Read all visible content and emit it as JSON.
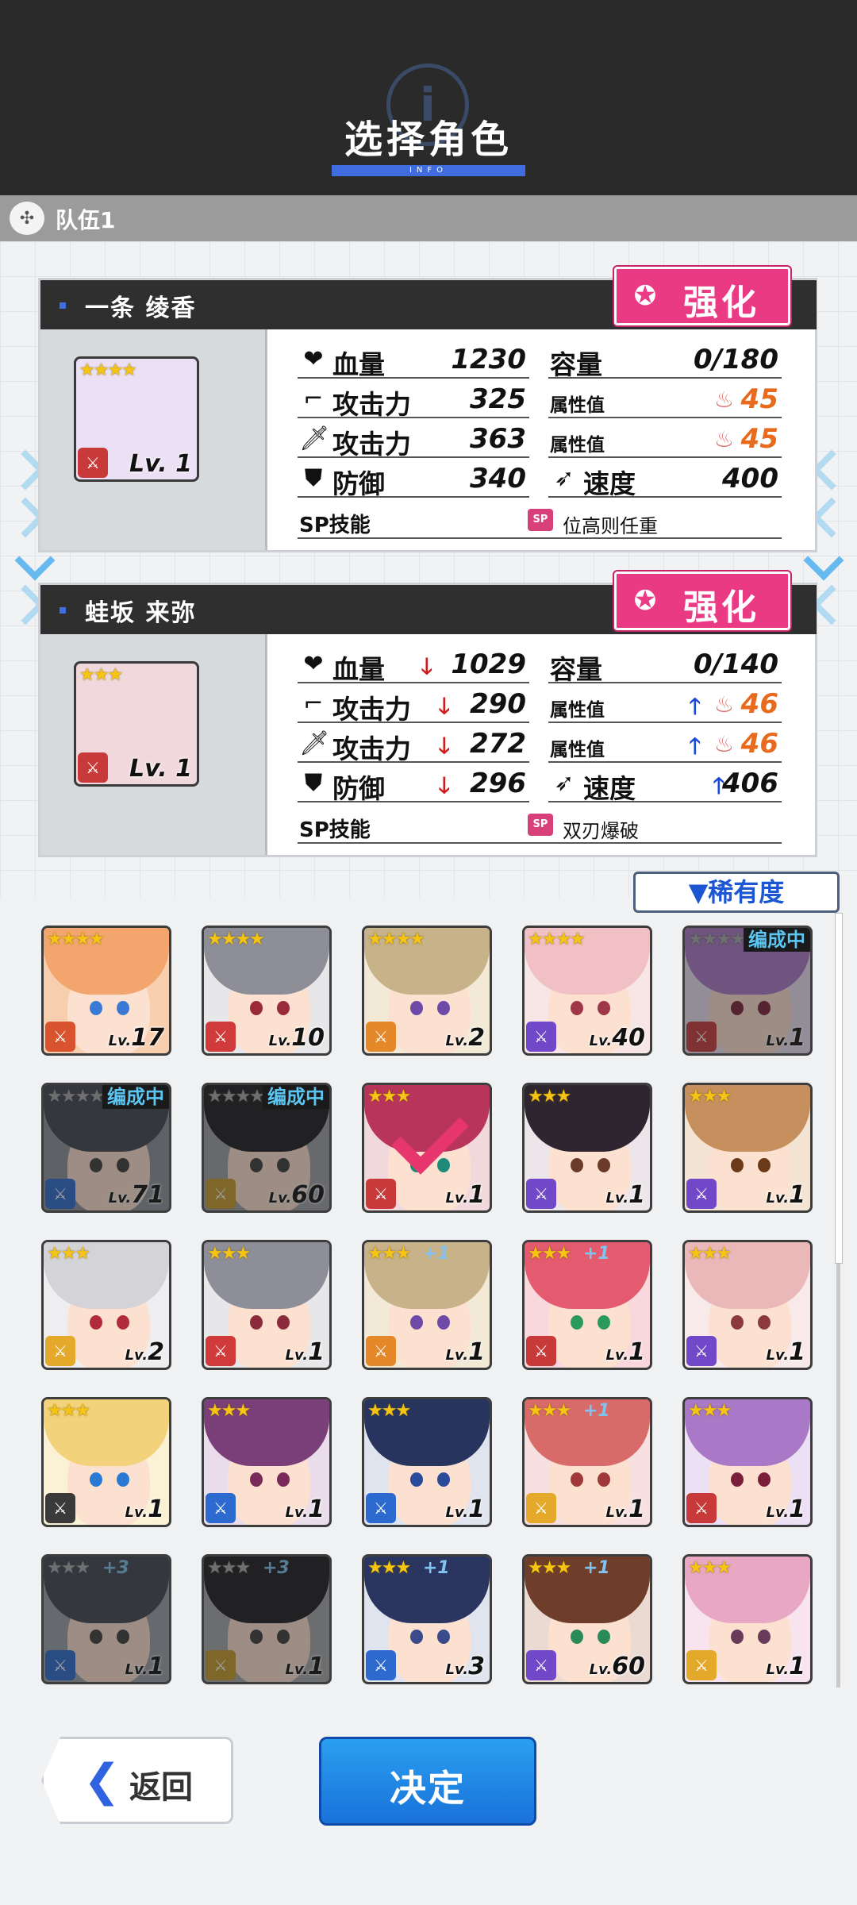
{
  "header": {
    "title": "选择角色",
    "bar_text": "INFO"
  },
  "team": {
    "label": "队伍1"
  },
  "cards": [
    {
      "name": "一条 绫香",
      "stars": "★★★★",
      "level": "Lv. 1",
      "enhance_label": "强化",
      "hp_label": "血量",
      "hp": "1230",
      "cap_label": "容量",
      "cap": "0/180",
      "atk1_label": "攻击力",
      "atk1": "325",
      "attr1_label": "属性值",
      "attr1": "45",
      "atk2_label": "攻击力",
      "atk2": "363",
      "attr2_label": "属性值",
      "attr2": "45",
      "def_label": "防御",
      "def": "340",
      "spd_label": "速度",
      "spd": "400",
      "sp_label": "SP技能",
      "sp_badge": "SP",
      "sp_name": "位高则任重",
      "hair": "#a978c6"
    },
    {
      "name": "蛙坂 来弥",
      "stars": "★★★",
      "level": "Lv. 1",
      "enhance_label": "强化",
      "hp_label": "血量",
      "hp": "1029",
      "cap_label": "容量",
      "cap": "0/140",
      "atk1_label": "攻击力",
      "atk1": "290",
      "attr1_label": "属性值",
      "attr1": "46",
      "atk2_label": "攻击力",
      "atk2": "272",
      "attr2_label": "属性值",
      "attr2": "46",
      "def_label": "防御",
      "def": "296",
      "spd_label": "速度",
      "spd": "406",
      "sp_label": "SP技能",
      "sp_badge": "SP",
      "sp_name": "双刃爆破",
      "hair": "#b8345a"
    }
  ],
  "sort": {
    "label": "▼稀有度"
  },
  "roster": [
    {
      "stars": "★★★★",
      "plus": "",
      "level": "17",
      "hair": "#f2a66e",
      "eye": "#3a7ad4",
      "bg": "#f8cfae",
      "weapon": "#d9532f",
      "status": ""
    },
    {
      "stars": "★★★★",
      "plus": "",
      "level": "10",
      "hair": "#8e8e98",
      "eye": "#9a2a3a",
      "bg": "#e7e7ea",
      "weapon": "#d03a3a",
      "status": ""
    },
    {
      "stars": "★★★★",
      "plus": "",
      "level": "2",
      "hair": "#c7b28a",
      "eye": "#6e4aa8",
      "bg": "#f2ead7",
      "weapon": "#e4882a",
      "status": ""
    },
    {
      "stars": "★★★★",
      "plus": "",
      "level": "40",
      "hair": "#f0c0c4",
      "eye": "#a0364a",
      "bg": "#f8e6e6",
      "weapon": "#7048c8",
      "status": ""
    },
    {
      "stars": "★★★★",
      "plus": "",
      "level": "1",
      "hair": "#a978c6",
      "eye": "#7a1f3a",
      "bg": "#ece0f4",
      "weapon": "#c83a3a",
      "status": "编成中"
    },
    {
      "stars": "★★★★",
      "plus": "",
      "level": "71",
      "hair": "#3e4450",
      "eye": "#3b3b3b",
      "bg": "#8a939c",
      "weapon": "#2d6ad0",
      "status": "编成中"
    },
    {
      "stars": "★★★★",
      "plus": "",
      "level": "60",
      "hair": "#1d1d22",
      "eye": "#3b3b3b",
      "bg": "#9b9ea4",
      "weapon": "#c79a2a",
      "status": "编成中"
    },
    {
      "stars": "★★★",
      "plus": "",
      "level": "1",
      "hair": "#b8345a",
      "eye": "#1e8a7a",
      "bg": "#f1d8dc",
      "weapon": "#c83a3a",
      "status": "selected"
    },
    {
      "stars": "★★★",
      "plus": "",
      "level": "1",
      "hair": "#2e2530",
      "eye": "#6a3a2a",
      "bg": "#ece6ea",
      "weapon": "#7048c8",
      "status": ""
    },
    {
      "stars": "★★★",
      "plus": "",
      "level": "1",
      "hair": "#c6905e",
      "eye": "#6a3a1a",
      "bg": "#f4e4d4",
      "weapon": "#7048c8",
      "status": ""
    },
    {
      "stars": "★★★",
      "plus": "",
      "level": "2",
      "hair": "#d4d4d8",
      "eye": "#b02a3a",
      "bg": "#eeeef0",
      "weapon": "#e4a92a",
      "status": ""
    },
    {
      "stars": "★★★",
      "plus": "",
      "level": "1",
      "hair": "#8e8e98",
      "eye": "#8a2a3a",
      "bg": "#e7e7ea",
      "weapon": "#d03a3a",
      "status": ""
    },
    {
      "stars": "★★★",
      "plus": "+1",
      "level": "1",
      "hair": "#c7b28a",
      "eye": "#6e4aa8",
      "bg": "#f2ead7",
      "weapon": "#e4882a",
      "status": ""
    },
    {
      "stars": "★★★",
      "plus": "+1",
      "level": "1",
      "hair": "#e45a6e",
      "eye": "#2a9a5a",
      "bg": "#f8d8dc",
      "weapon": "#c83a3a",
      "status": ""
    },
    {
      "stars": "★★★",
      "plus": "",
      "level": "1",
      "hair": "#eab8b8",
      "eye": "#8a3a3a",
      "bg": "#f8eaea",
      "weapon": "#7048c8",
      "status": ""
    },
    {
      "stars": "★★★",
      "plus": "",
      "level": "1",
      "hair": "#f2d27a",
      "eye": "#2a7ad4",
      "bg": "#fbf2d6",
      "weapon": "#3a3a3a",
      "status": ""
    },
    {
      "stars": "★★★",
      "plus": "",
      "level": "1",
      "hair": "#7a3e78",
      "eye": "#7a2a5a",
      "bg": "#eadcea",
      "weapon": "#2d6ad0",
      "status": ""
    },
    {
      "stars": "★★★",
      "plus": "",
      "level": "1",
      "hair": "#27355e",
      "eye": "#2a4a9a",
      "bg": "#e0e4ee",
      "weapon": "#2d6ad0",
      "status": ""
    },
    {
      "stars": "★★★",
      "plus": "+1",
      "level": "1",
      "hair": "#d86a6a",
      "eye": "#a03a3a",
      "bg": "#f8e0e0",
      "weapon": "#e4a92a",
      "status": ""
    },
    {
      "stars": "★★★",
      "plus": "",
      "level": "1",
      "hair": "#a978c6",
      "eye": "#7a1f3a",
      "bg": "#ece0f4",
      "weapon": "#c83a3a",
      "status": ""
    },
    {
      "stars": "★★★",
      "plus": "+3",
      "level": "1",
      "hair": "#3e4450",
      "eye": "#3b3b3b",
      "bg": "#9aa0a8",
      "weapon": "#2d6ad0",
      "status": "dim"
    },
    {
      "stars": "★★★",
      "plus": "+3",
      "level": "1",
      "hair": "#1d1d22",
      "eye": "#3b3b3b",
      "bg": "#a4a6aa",
      "weapon": "#c79a2a",
      "status": "dim"
    },
    {
      "stars": "★★★",
      "plus": "+1",
      "level": "3",
      "hair": "#2a3560",
      "eye": "#3a4a8a",
      "bg": "#e0e4ee",
      "weapon": "#2d6ad0",
      "status": ""
    },
    {
      "stars": "★★★",
      "plus": "+1",
      "level": "60",
      "hair": "#6e3e2a",
      "eye": "#2a8a5a",
      "bg": "#eadad2",
      "weapon": "#7048c8",
      "status": ""
    },
    {
      "stars": "★★★",
      "plus": "",
      "level": "1",
      "hair": "#e8a8c4",
      "eye": "#6a3a5a",
      "bg": "#f8e4ee",
      "weapon": "#e4a92a",
      "status": ""
    }
  ],
  "footer": {
    "back_label": "返回",
    "confirm_label": "决定"
  }
}
